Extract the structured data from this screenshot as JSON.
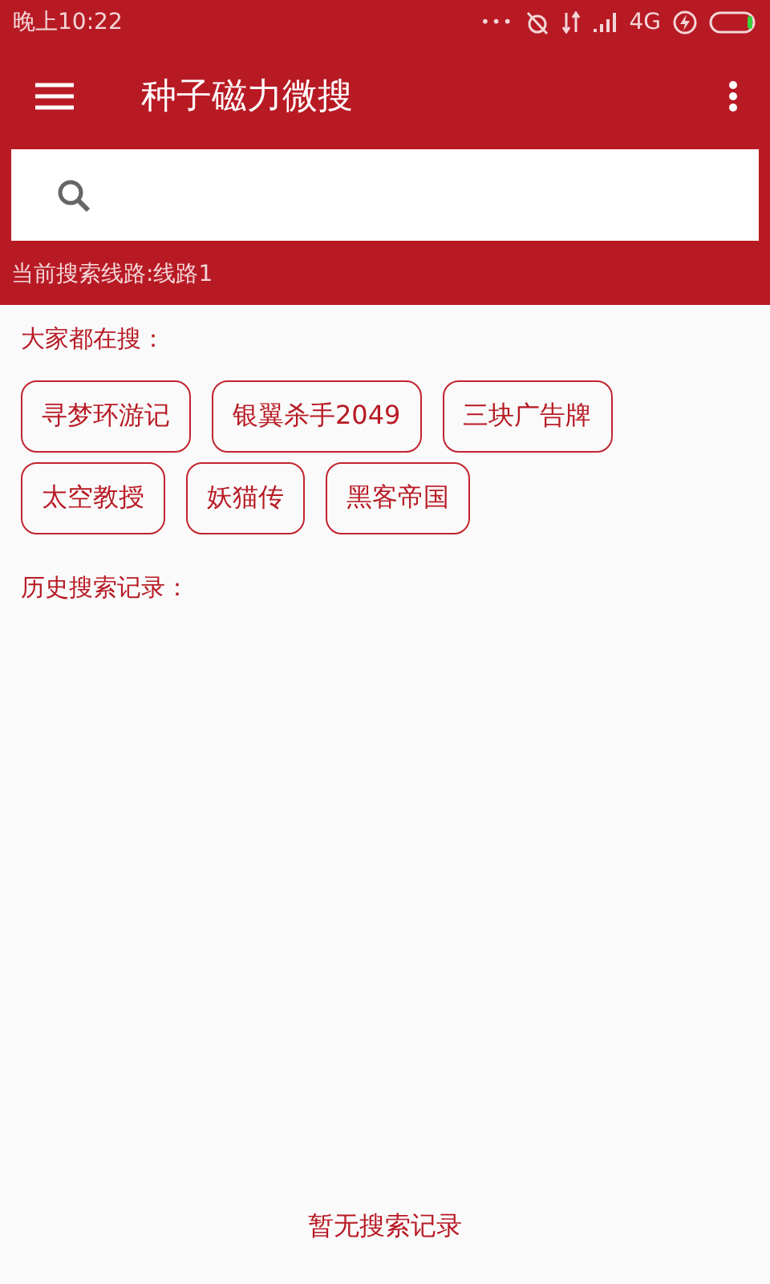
{
  "status_bar": {
    "time": "晚上10:22",
    "dots": "•••",
    "network": "4G"
  },
  "toolbar": {
    "title": "种子磁力微搜"
  },
  "search": {
    "route": "当前搜索线路:线路1"
  },
  "hot": {
    "heading": "大家都在搜：",
    "tags": [
      "寻梦环游记",
      "银翼杀手2049",
      "三块广告牌",
      "太空教授",
      "妖猫传",
      "黑客帝国"
    ]
  },
  "history": {
    "heading": "历史搜索记录：",
    "empty": "暂无搜索记录"
  }
}
